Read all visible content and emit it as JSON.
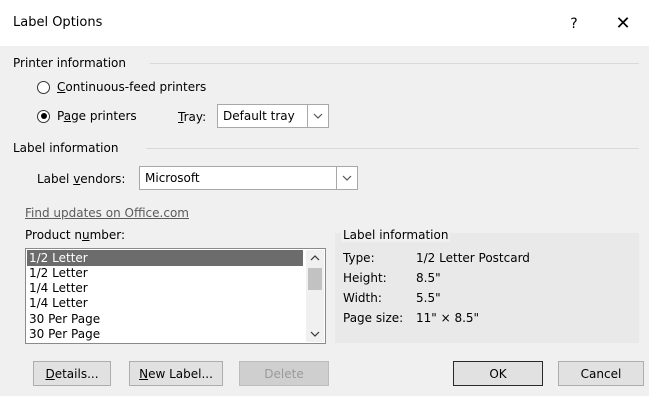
{
  "window": {
    "title": "Label Options",
    "help": "?",
    "close": "✕"
  },
  "printer_info": {
    "heading": "Printer information",
    "continuous_pre": "",
    "continuous_u": "C",
    "continuous_post": "ontinuous-feed printers",
    "page_pre": "P",
    "page_u": "a",
    "page_post": "ge printers",
    "tray_u": "T",
    "tray_post": "ray:",
    "tray_value": "Default tray",
    "selected": "page"
  },
  "label_info": {
    "heading": "Label information",
    "vendor_pre": "Label ",
    "vendor_u": "v",
    "vendor_post": "endors:",
    "vendor_value": "Microsoft"
  },
  "find_updates": "Find updates on Office.com",
  "product": {
    "label_pre": "Product n",
    "label_u": "u",
    "label_post": "mber:",
    "items": [
      "1/2 Letter",
      "1/2 Letter",
      "1/4 Letter",
      "1/4 Letter",
      "30 Per Page",
      "30 Per Page"
    ],
    "selected_index": 0
  },
  "panel": {
    "title": "Label information",
    "type_label": "Type:",
    "type_value": "1/2 Letter Postcard",
    "height_label": "Height:",
    "height_value": "8.5\"",
    "width_label": "Width:",
    "width_value": "5.5\"",
    "pagesize_label": "Page size:",
    "pagesize_value": "11\" × 8.5\""
  },
  "buttons": {
    "details_u": "D",
    "details_post": "etails...",
    "newlabel_u": "N",
    "newlabel_post": "ew Label...",
    "delete": "Delete",
    "ok": "OK",
    "cancel": "Cancel"
  },
  "icons": {
    "chevron": "chevron-down-icon",
    "help": "help-icon",
    "close": "close-icon"
  }
}
